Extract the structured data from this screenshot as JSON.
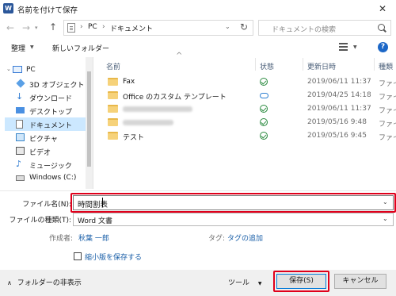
{
  "window": {
    "title": "名前を付けて保存",
    "app_icon": "W"
  },
  "address": {
    "segments": [
      "PC",
      "ドキュメント"
    ],
    "separators": [
      "›",
      "›"
    ],
    "search_placeholder": "ドキュメントの検索"
  },
  "toolbar": {
    "organize": "整理",
    "new_folder": "新しいフォルダー",
    "help": "?"
  },
  "sidebar": {
    "items": [
      {
        "label": "PC",
        "icon": "pc-icon"
      },
      {
        "label": "3D オブジェクト",
        "icon": "3d-objects-icon"
      },
      {
        "label": "ダウンロード",
        "icon": "download-icon"
      },
      {
        "label": "デスクトップ",
        "icon": "desktop-icon"
      },
      {
        "label": "ドキュメント",
        "icon": "documents-icon"
      },
      {
        "label": "ピクチャ",
        "icon": "pictures-icon"
      },
      {
        "label": "ビデオ",
        "icon": "videos-icon"
      },
      {
        "label": "ミュージック",
        "icon": "music-icon"
      },
      {
        "label": "Windows (C:)",
        "icon": "drive-icon"
      }
    ]
  },
  "columns": {
    "name": "名前",
    "status": "状態",
    "modified": "更新日時",
    "type": "種類"
  },
  "files": [
    {
      "name": "Fax",
      "status": "synced",
      "modified": "2019/06/11 11:37",
      "type": "ファイル"
    },
    {
      "name": "Office のカスタム テンプレート",
      "status": "cloud",
      "modified": "2019/04/25 14:18",
      "type": "ファイル"
    },
    {
      "name": "",
      "status": "synced",
      "modified": "2019/06/11 11:37",
      "type": "ファイル"
    },
    {
      "name": "",
      "status": "synced",
      "modified": "2019/05/16 9:48",
      "type": "ファイル"
    },
    {
      "name": "テスト",
      "status": "synced",
      "modified": "2019/05/16 9:45",
      "type": "ファイル"
    }
  ],
  "form": {
    "filename_label": "ファイル名(N):",
    "filename_value": "時間割表",
    "filetype_label": "ファイルの種類(T):",
    "filetype_value": "Word 文書",
    "author_label": "作成者:",
    "author_value": "秋葉 一郎",
    "tags_label": "タグ:",
    "tags_value": "タグの追加",
    "thumbnail_label": "縮小版を保存する"
  },
  "footer": {
    "hide_folders": "フォルダーの非表示",
    "tools": "ツール",
    "save": "保存(S)",
    "cancel": "キャンセル"
  },
  "colors": {
    "highlight": "#e0001b",
    "selected": "#cce8ff",
    "link": "#1a5fa8"
  }
}
